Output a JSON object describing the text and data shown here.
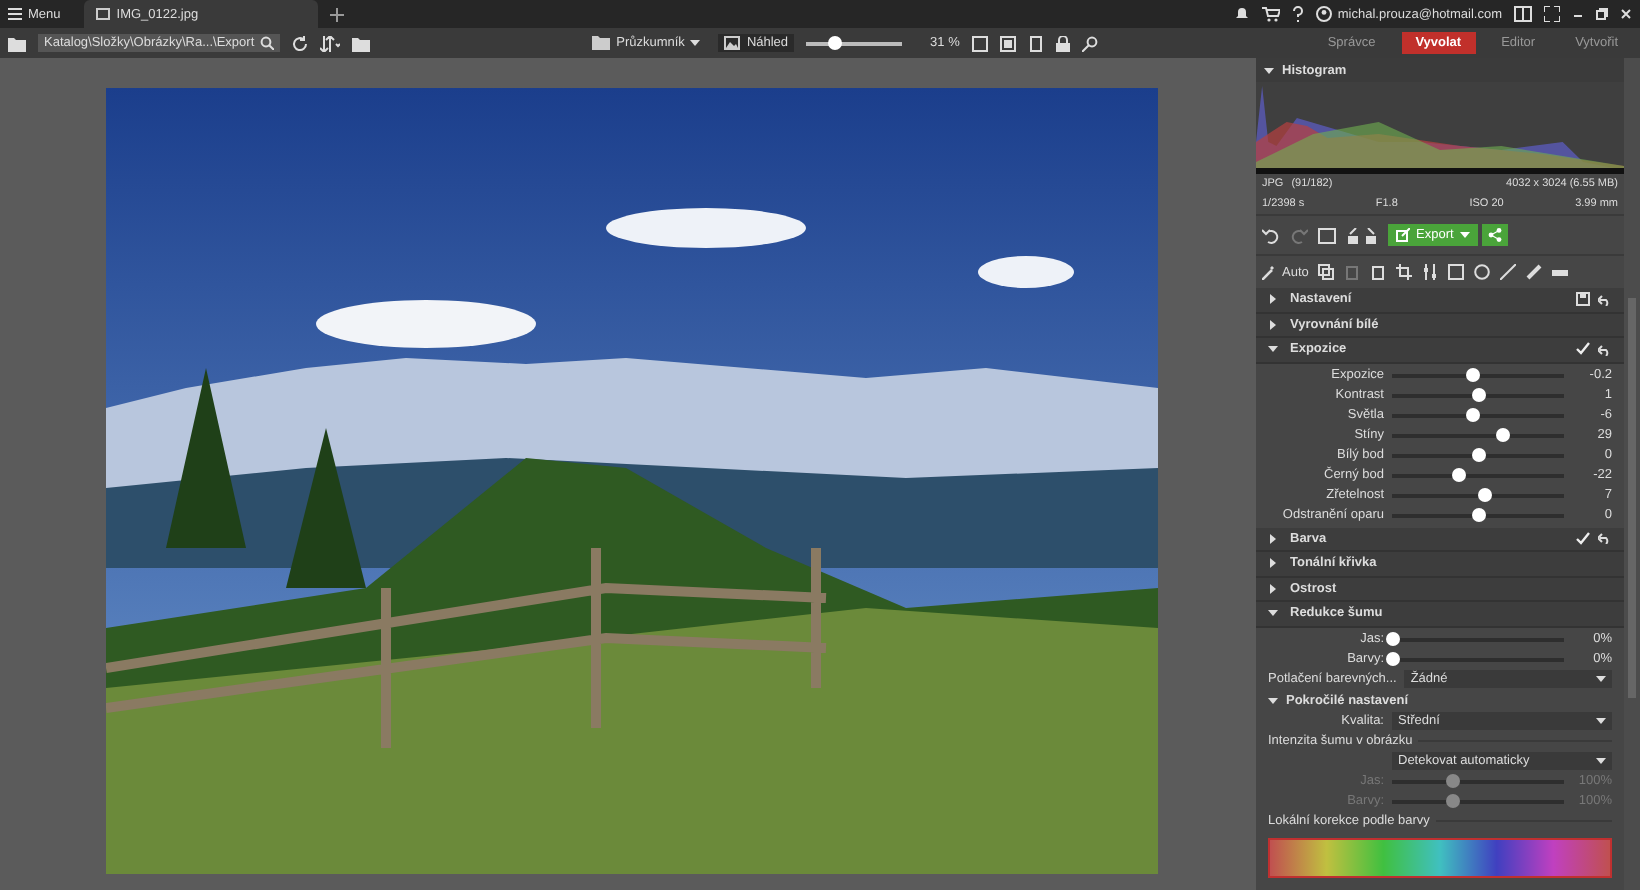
{
  "top_bar": {
    "menu_label": "Menu",
    "tab_title": "IMG_0122.jpg",
    "user_email": "michal.prouza@hotmail.com"
  },
  "toolbar": {
    "path": "Katalog\\Složky\\Obrázky\\Ra...\\Export",
    "browser_label": "Průzkumník",
    "preview_label": "Náhled",
    "zoom": {
      "level": 0.3
    },
    "zoom_reading": "31 %"
  },
  "modes": [
    {
      "label": "Správce",
      "selected": false
    },
    {
      "label": "Vyvolat",
      "selected": true
    },
    {
      "label": "Editor",
      "selected": false
    },
    {
      "label": "Vytvořit",
      "selected": false
    }
  ],
  "histogram": {
    "title": "Histogram",
    "format": "JPG",
    "index": "(91/182)",
    "dimensions": "4032 x 3024 (6.55 MB)",
    "shutter": "1/2398 s",
    "aperture": "F1.8",
    "iso": "ISO 20",
    "focal": "3.99 mm"
  },
  "actions": {
    "export_label": "Export",
    "auto_label": "Auto"
  },
  "sections": [
    {
      "kind": "preset",
      "title": "Nastavení",
      "expanded": false,
      "enabled": false
    },
    {
      "kind": "section",
      "title": "Vyrovnání bílé",
      "expanded": false,
      "enabled": false
    },
    {
      "kind": "section",
      "title": "Expozice",
      "expanded": true,
      "enabled": true,
      "items": [
        {
          "kind": "slider",
          "label": "Expozice",
          "level": 0.47,
          "reading": "-0.2",
          "disabled": false
        },
        {
          "kind": "slider",
          "label": "Kontrast",
          "level": 0.5,
          "reading": "1",
          "disabled": false
        },
        {
          "kind": "slider",
          "label": "Světla",
          "level": 0.47,
          "reading": "-6",
          "disabled": false
        },
        {
          "kind": "slider",
          "label": "Stíny",
          "level": 0.64,
          "reading": "29",
          "disabled": false
        },
        {
          "kind": "slider",
          "label": "Bílý bod",
          "level": 0.5,
          "reading": "0",
          "disabled": false
        },
        {
          "kind": "slider",
          "label": "Černý bod",
          "level": 0.39,
          "reading": "-22",
          "disabled": false
        },
        {
          "kind": "slider",
          "label": "Zřetelnost",
          "level": 0.54,
          "reading": "7",
          "disabled": false
        },
        {
          "kind": "slider",
          "label": "Odstranění oparu",
          "level": 0.5,
          "reading": "0",
          "disabled": false
        }
      ]
    },
    {
      "kind": "section",
      "title": "Barva",
      "expanded": false,
      "enabled": true
    },
    {
      "kind": "section",
      "title": "Tonální křivka",
      "expanded": false,
      "enabled": false
    },
    {
      "kind": "section",
      "title": "Ostrost",
      "expanded": false,
      "enabled": false
    },
    {
      "kind": "section",
      "title": "Redukce šumu",
      "expanded": true,
      "enabled": false,
      "items": [
        {
          "kind": "slider",
          "label": "Jas:",
          "level": 0,
          "reading": "0%",
          "disabled": false
        },
        {
          "kind": "slider",
          "label": "Barvy:",
          "level": 0,
          "reading": "0%",
          "disabled": false
        },
        {
          "kind": "dropdown",
          "label": "Potlačení barevných...",
          "value": "Žádné"
        },
        {
          "kind": "subheader",
          "label": "Pokročilé nastavení"
        },
        {
          "kind": "dropdown",
          "label": "Kvalita:",
          "value": "Střední"
        },
        {
          "kind": "group",
          "label": "Intenzita šumu v obrázku"
        },
        {
          "kind": "dropdown",
          "value": "Detekovat automaticky"
        },
        {
          "kind": "slider",
          "label": "Jas:",
          "level": 0.35,
          "reading": "100%",
          "disabled": true
        },
        {
          "kind": "slider",
          "label": "Barvy:",
          "level": 0.35,
          "reading": "100%",
          "disabled": true
        },
        {
          "kind": "group",
          "label": "Lokální korekce podle barvy"
        },
        {
          "kind": "spectrum"
        }
      ]
    }
  ]
}
